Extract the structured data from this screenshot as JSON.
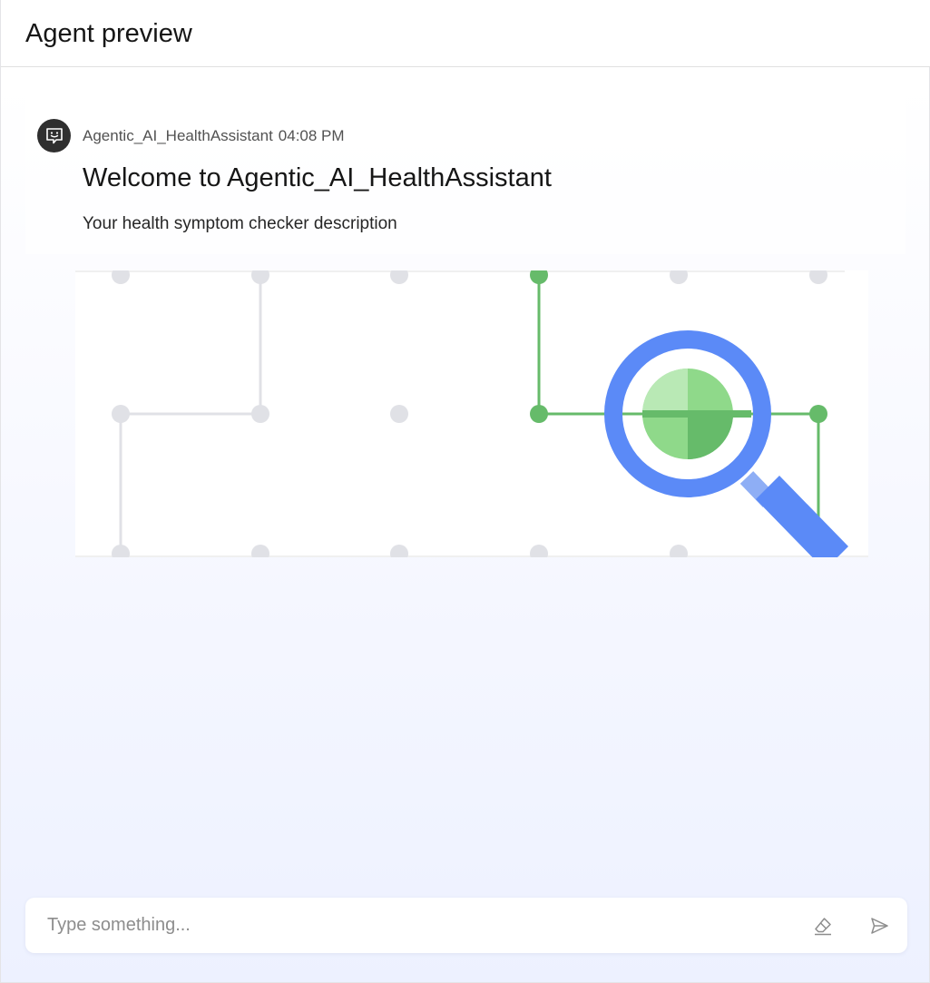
{
  "header": {
    "title": "Agent preview"
  },
  "message": {
    "sender": "Agentic_AI_HealthAssistant",
    "time": "04:08 PM",
    "avatar_icon": "chat-bot-icon",
    "welcome_title": "Welcome to Agentic_AI_HealthAssistant",
    "description": "Your health symptom checker description",
    "illustration": "magnifying-glass-network-illustration"
  },
  "composer": {
    "placeholder": "Type something...",
    "value": "",
    "clear_icon": "eraser-icon",
    "send_icon": "send-icon"
  },
  "colors": {
    "network_gray": "#e0e1e6",
    "network_green": "#66bb6a",
    "magnifier_blue": "#5b8af7",
    "lens_light_green": "#b9e9b5",
    "lens_mid_green": "#8fd98a",
    "lens_dark_green": "#66bb6a"
  }
}
